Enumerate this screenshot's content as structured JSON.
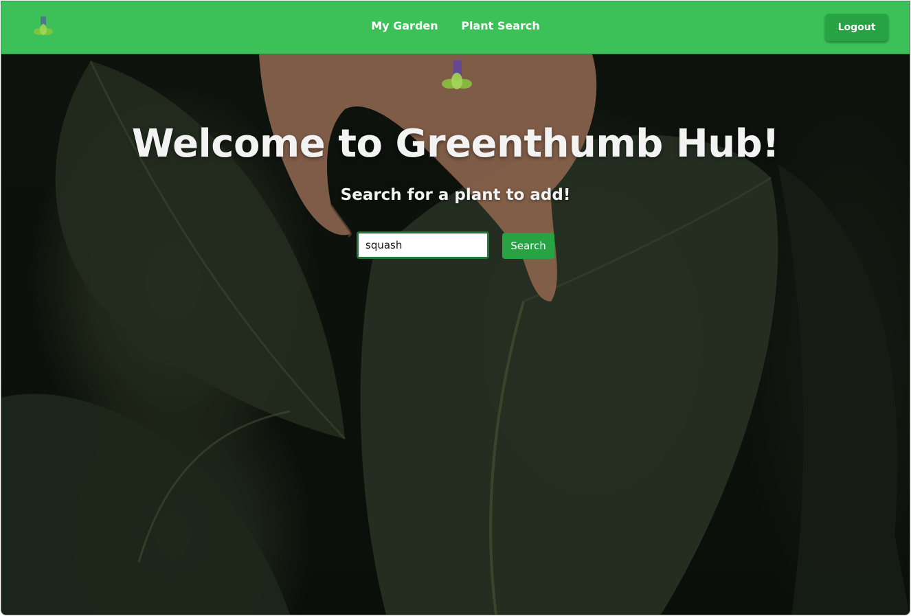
{
  "colors": {
    "navbar": "#3bc157",
    "button": "#27a344",
    "input_border": "#1f7a34",
    "text_light": "#f3f3f3"
  },
  "navbar": {
    "logo_icon": "lotus-logo-icon",
    "links": [
      {
        "label": "My Garden"
      },
      {
        "label": "Plant Search"
      }
    ],
    "logout_label": "Logout"
  },
  "hero": {
    "logo_icon": "lotus-logo-icon",
    "title": "Welcome to Greenthumb Hub!",
    "subtitle": "Search for a plant to add!",
    "search": {
      "value": "squash",
      "button_label": "Search"
    }
  }
}
